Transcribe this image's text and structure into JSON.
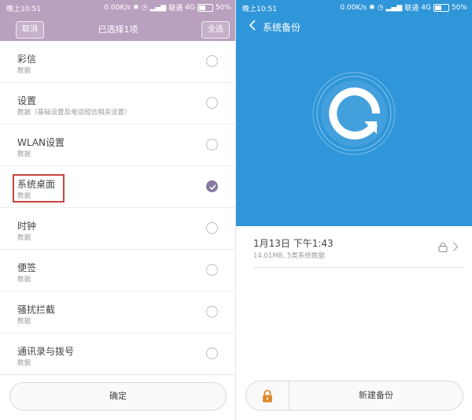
{
  "left": {
    "status": {
      "time": "晚上10:51",
      "speed": "0.00K/s",
      "carrier": "联通",
      "network": "4G",
      "battery": "50%"
    },
    "header": {
      "cancel": "取消",
      "title": "已选择1项",
      "select_all": "全选"
    },
    "items": [
      {
        "title": "彩信",
        "sub": "数据",
        "checked": false
      },
      {
        "title": "设置",
        "sub": "数据（基础设置及电话短信相关设置）",
        "checked": false
      },
      {
        "title": "WLAN设置",
        "sub": "数据",
        "checked": false
      },
      {
        "title": "系统桌面",
        "sub": "数据",
        "checked": true
      },
      {
        "title": "时钟",
        "sub": "数据",
        "checked": false
      },
      {
        "title": "便签",
        "sub": "数据",
        "checked": false
      },
      {
        "title": "骚扰拦截",
        "sub": "数据",
        "checked": false
      },
      {
        "title": "通讯录与拨号",
        "sub": "数据",
        "checked": false
      }
    ],
    "confirm": "确定",
    "colors": {
      "header": "#b9a0bf",
      "check": "#86789e",
      "highlight": "#c8443e"
    }
  },
  "right": {
    "status": {
      "time": "晚上10:51",
      "speed": "0.00K/s",
      "carrier": "联通",
      "network": "4G",
      "battery": "50%"
    },
    "title": "系统备份",
    "backup": {
      "title": "1月13日 下午1:43",
      "sub": "14.01MB, 5类系统数据"
    },
    "new_backup": "新建备份",
    "colors": {
      "header": "#2f96d9",
      "lock": "#e08a2e"
    }
  }
}
